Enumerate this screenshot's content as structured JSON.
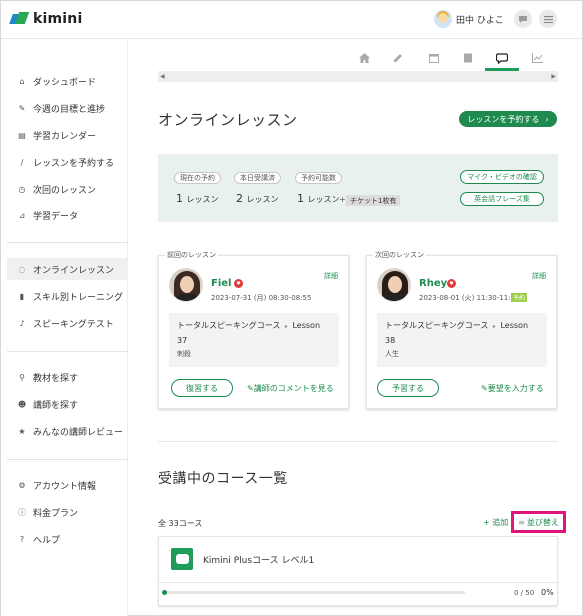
{
  "header": {
    "logo_text": "kimini",
    "user_name": "田中 ひよこ",
    "chat_icon": "chat-bubble-icon",
    "menu_icon": "hamburger-icon"
  },
  "sidebar": {
    "group1": [
      {
        "label": "ダッシュボード",
        "icon": "home-icon"
      },
      {
        "label": "今週の目標と進捗",
        "icon": "pencil-icon"
      },
      {
        "label": "学習カレンダー",
        "icon": "calendar-icon"
      },
      {
        "label": "レッスンを予約する",
        "icon": "pen-icon"
      },
      {
        "label": "次回のレッスン",
        "icon": "alarm-clock-icon"
      },
      {
        "label": "学習データ",
        "icon": "chart-icon"
      }
    ],
    "group2": [
      {
        "label": "オンラインレッスン",
        "icon": "chat-icon"
      },
      {
        "label": "スキル別トレーニング",
        "icon": "book-icon"
      },
      {
        "label": "スピーキングテスト",
        "icon": "microphone-icon"
      }
    ],
    "group3": [
      {
        "label": "教材を探す",
        "icon": "search-icon"
      },
      {
        "label": "講師を探す",
        "icon": "people-icon"
      },
      {
        "label": "みんなの講師レビュー",
        "icon": "star-icon"
      }
    ],
    "group4": [
      {
        "label": "アカウント情報",
        "icon": "settings-icon"
      },
      {
        "label": "料金プラン",
        "icon": "info-icon"
      },
      {
        "label": "ヘルプ",
        "icon": "help-icon"
      }
    ]
  },
  "tabs": [
    "home-icon",
    "pencil-icon",
    "calendar-icon",
    "book-icon",
    "chat-icon",
    "chart-icon"
  ],
  "main": {
    "title": "オンラインレッスン",
    "reserve_button": "レッスンを予約する"
  },
  "stats": {
    "current_label": "現在の予約",
    "current_value": "1",
    "today_label": "本日受講済",
    "today_value": "2",
    "available_label": "予約可能数",
    "available_value": "1",
    "unit": "レッスン",
    "plus": "+",
    "ticket": "チケット1枚有",
    "mic_check": "マイク・ビデオの確認",
    "phrases": "英会話フレーズ集"
  },
  "previous_lesson": {
    "legend": "前回のレッスン",
    "teacher": "Fiel",
    "detail": "詳細",
    "date": "2023-07-31 (月) 08:30-08:55",
    "course": "トータルスピーキングコース",
    "sep": "▸",
    "lesson_word": "Lesson",
    "lesson_number": "37",
    "topic": "刺殺",
    "review_button": "復習する",
    "comment_link": "講師のコメントを見る"
  },
  "next_lesson": {
    "legend": "次回のレッスン",
    "teacher": "Rhey",
    "detail": "詳細",
    "date": "2023-08-01 (火) 11:30-11:55",
    "badge": "予約",
    "course": "トータルスピーキングコース",
    "sep": "▸",
    "lesson_word": "Lesson",
    "lesson_number": "38",
    "topic": "人生",
    "prepare_button": "予習する",
    "request_link": "要望を入力する"
  },
  "courses": {
    "title": "受講中のコース一覧",
    "count": "全 33コース",
    "add": "+ 追加",
    "sort": "並び替え",
    "items": [
      {
        "name": "Kimini Plusコース レベル1",
        "progress_count": "0 / 50",
        "progress_pct": "0%",
        "progress": 0
      }
    ]
  },
  "colors": {
    "accent": "#1e8a4e",
    "highlight": "#e0137f"
  }
}
